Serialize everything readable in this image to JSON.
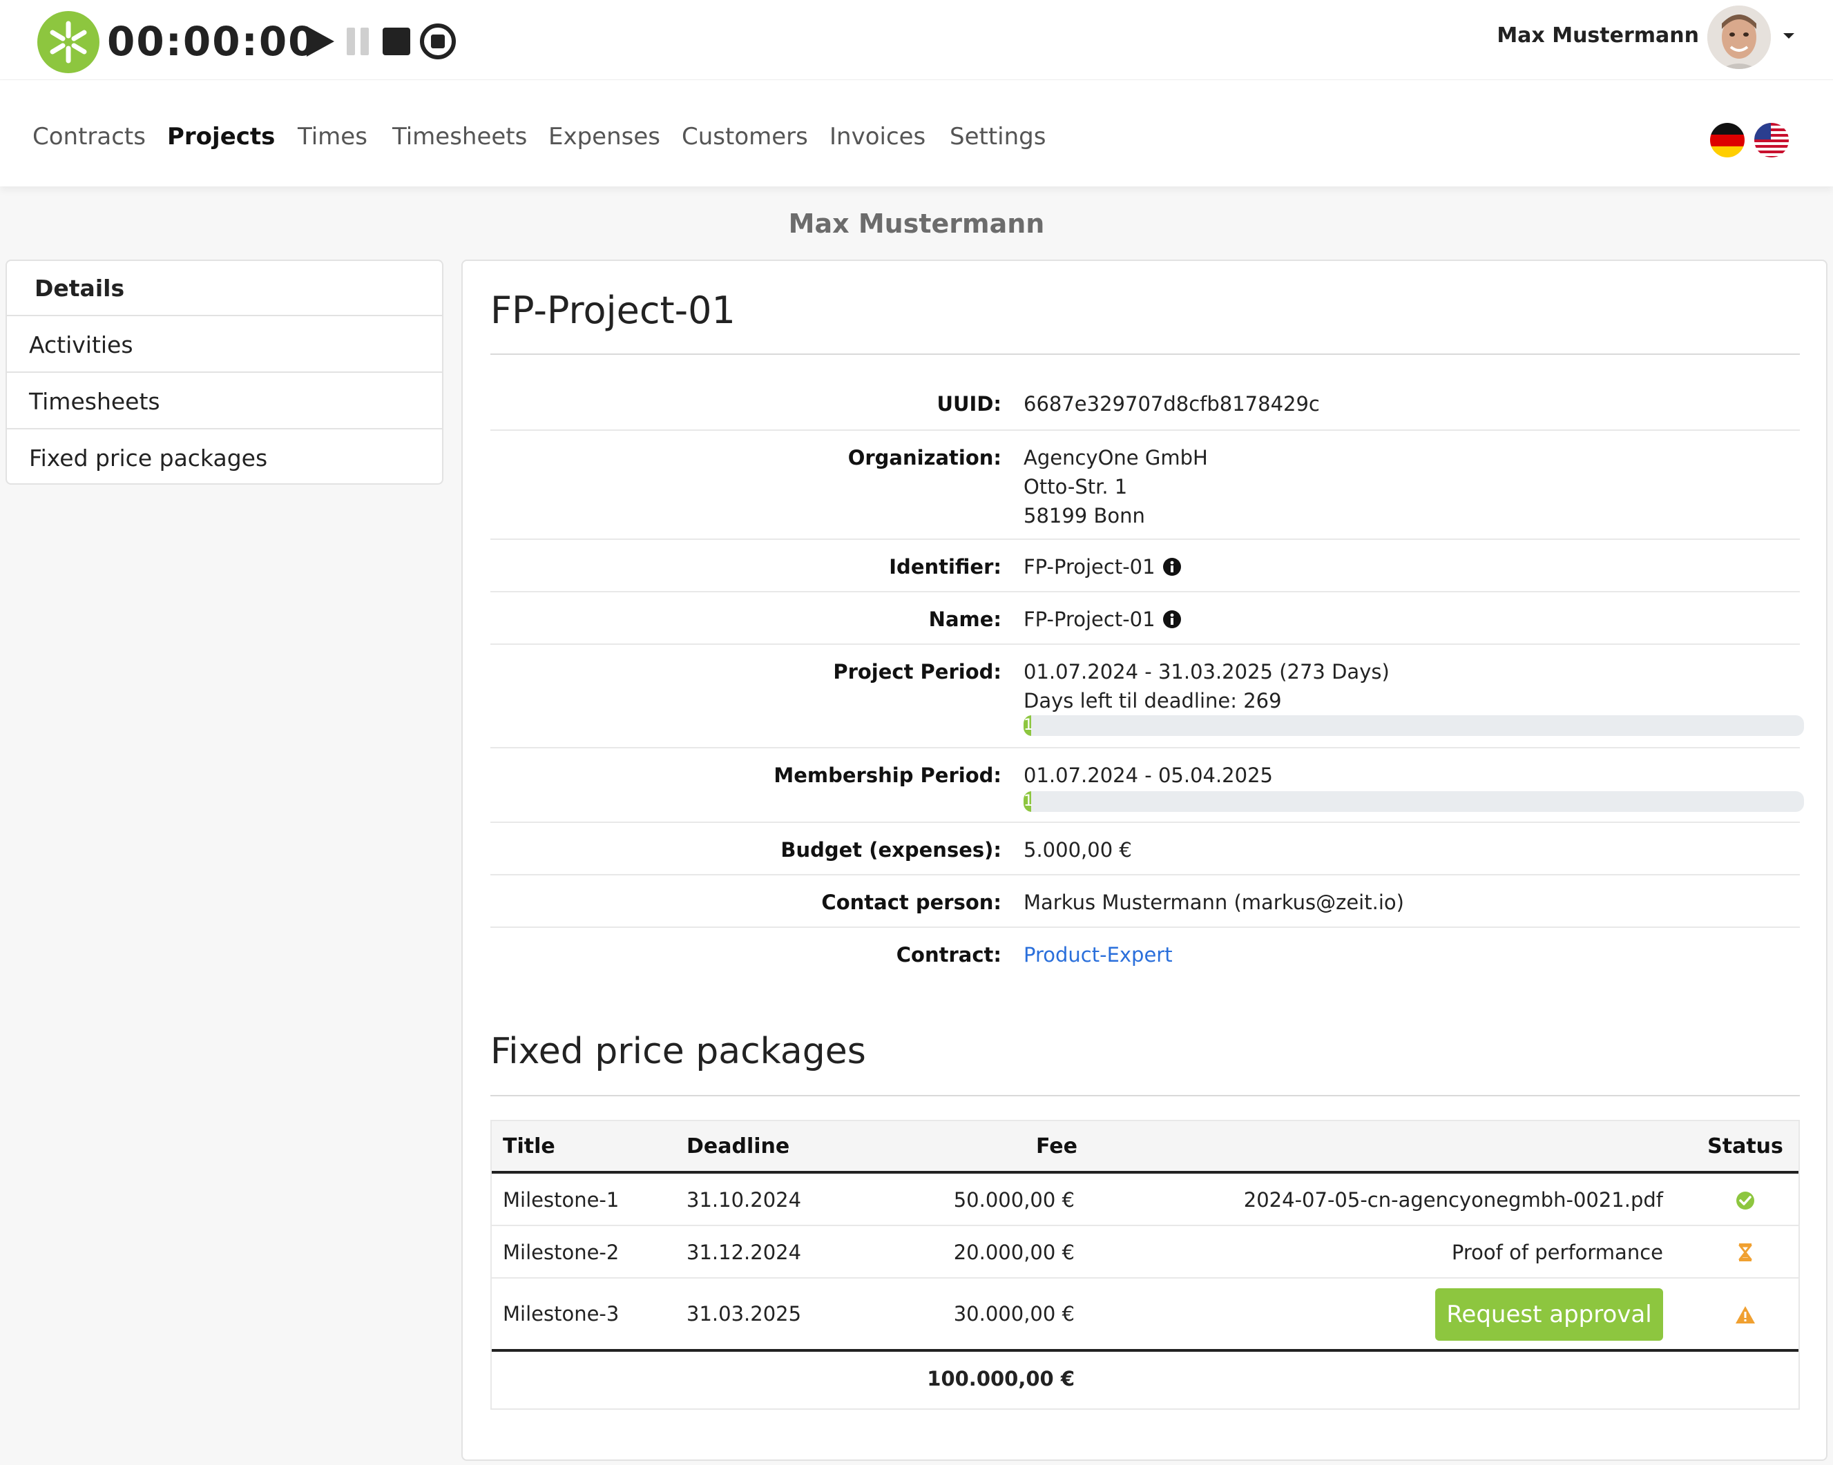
{
  "topbar": {
    "timer": "00:00:00",
    "user_name": "Max Mustermann"
  },
  "nav": {
    "items": [
      "Contracts",
      "Projects",
      "Times",
      "Timesheets",
      "Expenses",
      "Customers",
      "Invoices",
      "Settings"
    ],
    "active": "Projects"
  },
  "page_user": "Max Mustermann",
  "sidebar": {
    "items": [
      "Details",
      "Activities",
      "Timesheets",
      "Fixed price packages"
    ]
  },
  "project": {
    "title": "FP-Project-01",
    "labels": {
      "uuid": "UUID:",
      "organization": "Organization:",
      "identifier": "Identifier:",
      "name": "Name:",
      "project_period": "Project Period:",
      "membership_period": "Membership Period:",
      "budget": "Budget (expenses):",
      "contact": "Contact person:",
      "contract": "Contract:"
    },
    "uuid": "6687e329707d8cfb8178429c",
    "organization": {
      "name": "AgencyOne GmbH",
      "street": "Otto-Str. 1",
      "city": "58199 Bonn"
    },
    "identifier": "FP-Project-01",
    "name": "FP-Project-01",
    "project_period": "01.07.2024 - 31.03.2025 (273 Days)",
    "days_left": "Days left til deadline: 269",
    "project_progress": {
      "percent": 1,
      "label": "1"
    },
    "membership_period": "01.07.2024 - 05.04.2025",
    "membership_progress": {
      "percent": 1,
      "label": "1"
    },
    "budget": "5.000,00 €",
    "contact": "Markus Mustermann (markus@zeit.io)",
    "contract": "Product-Expert"
  },
  "packages": {
    "heading": "Fixed price packages",
    "columns": {
      "title": "Title",
      "deadline": "Deadline",
      "fee": "Fee",
      "status": "Status"
    },
    "rows": [
      {
        "title": "Milestone-1",
        "deadline": "31.10.2024",
        "fee": "50.000,00 €",
        "action": "2024-07-05-cn-agencyonegmbh-0021.pdf",
        "status_icon": "check-circle-icon"
      },
      {
        "title": "Milestone-2",
        "deadline": "31.12.2024",
        "fee": "20.000,00 €",
        "action": "Proof of performance",
        "status_icon": "hourglass-icon"
      },
      {
        "title": "Milestone-3",
        "deadline": "31.03.2025",
        "fee": "30.000,00 €",
        "action": "Request approval",
        "status_icon": "warning-icon"
      }
    ],
    "total": "100.000,00 €"
  },
  "colors": {
    "accent": "#8dc63f",
    "link": "#2a6fdb",
    "warning": "#f0a030"
  }
}
